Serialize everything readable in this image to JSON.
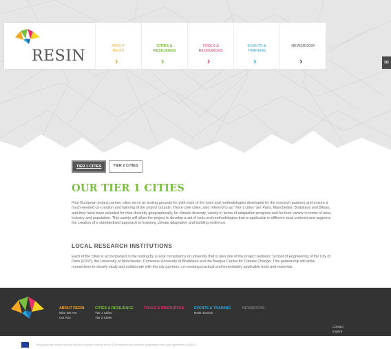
{
  "brand": {
    "logo_text": "RESIN",
    "colors": {
      "green": "#7bbf3f",
      "orange": "#f5a623",
      "pink": "#e8336d",
      "blue": "#29abe2",
      "dark": "#333333"
    }
  },
  "nav": {
    "items": [
      {
        "label": "ABOUT RESIN",
        "color": "#f5b342",
        "arrow": "chevron-right"
      },
      {
        "label": "CITIES & RESILIENCE",
        "color": "#7bbf3f",
        "arrow": "chevron-right"
      },
      {
        "label": "TOOLS & RESOURCES",
        "color": "#e8336d",
        "arrow": "chevron-right"
      },
      {
        "label": "EVENTS & TRAINING",
        "color": "#29abe2",
        "arrow": "chevron-right"
      },
      {
        "label": "NEWSROOM",
        "color": "#555555",
        "arrow": "chevron-right"
      }
    ]
  },
  "side_tab": {
    "icon": "mail-icon",
    "glyph": "✉"
  },
  "tabs": [
    {
      "label": "TIER 1 CITIES",
      "active": true
    },
    {
      "label": "TIER 2 CITIES",
      "active": false
    }
  ],
  "content": {
    "title": "OUR TIER 1 CITIES",
    "paragraph1": "Four European project partner cities serve as testing grounds for pilot trials of the tools and methodologies developed by the research partners and ensure a much-needed co-creation and tailoring of the project outputs. These core cities, also referred to as \"Tier 1 cities\" are Paris, Manchester, Bratislava and Bilbao, and they have been selected for their diversity geographically, for climate diversity, variety in terms of adaptation progress and for their variety in terms of area, industry and population. This variety will allow the project to develop a set of tools and methodologies that is applicable in different local contexts and supports the creation of a standardised approach to fostering climate adaptation and building resilience.",
    "subheading": "LOCAL RESEARCH INSTITUTIONS",
    "paragraph2": "Each of the cities is accompanied in the testing by a local consultancy or university that is also one of the project partners: School of Engineering of the City of Paris (EIVP), the University of Manchester, Comenius University of Bratislava and the Basque Centre for Climate Change. This partnership will allow researchers to closely study and collaborate with the city partners, co-creating practical and immediately applicable tools and materials."
  },
  "footer": {
    "columns": [
      {
        "head": "ABOUT RESIN",
        "color": "#f5a623",
        "links": [
          "Who We Are",
          "Our Aim"
        ]
      },
      {
        "head": "CITIES & RESILIENCE",
        "color": "#7bbf3f",
        "links": [
          "Tier 1 Cities",
          "Tier 2 Cities"
        ]
      },
      {
        "head": "TOOLS & RESOURCES",
        "color": "#e8336d",
        "links": []
      },
      {
        "head": "EVENTS & TRAINING",
        "color": "#29abe2",
        "links": [
          "Resin Events"
        ]
      },
      {
        "head": "NEWSROOM",
        "color": "#777777",
        "links": []
      }
    ],
    "right_links": [
      "Contact",
      "Imprint"
    ]
  },
  "eu_notice": "This project has received funding from the European Union's Horizon 2020 research and innovation programme under grant agreement no 653522."
}
